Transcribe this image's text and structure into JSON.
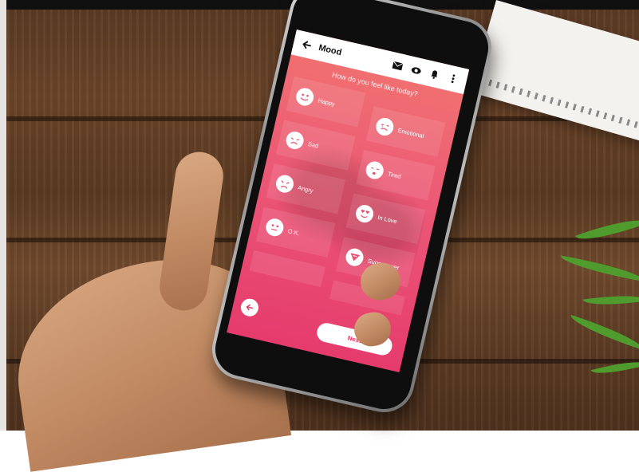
{
  "app_bar": {
    "title": "Mood",
    "back_icon": "arrow-left-icon",
    "icons": [
      "envelope-icon",
      "eye-icon",
      "bell-icon",
      "more-vert-icon"
    ]
  },
  "question": "How do you feel like today?",
  "moods": [
    {
      "label": "Happy",
      "icon": "smile-face-icon"
    },
    {
      "label": "Emotional",
      "icon": "emotional-face-icon"
    },
    {
      "label": "Sad",
      "icon": "sad-face-icon"
    },
    {
      "label": "Tired",
      "icon": "tired-face-icon"
    },
    {
      "label": "Angry",
      "icon": "angry-face-icon"
    },
    {
      "label": "In Love",
      "icon": "heart-eyes-face-icon"
    },
    {
      "label": "O.K.",
      "icon": "neutral-face-icon"
    },
    {
      "label": "Superpower",
      "icon": "superhero-shield-icon"
    }
  ],
  "next_button": {
    "label": "Next"
  },
  "colors": {
    "gradient_top": "#f1746f",
    "gradient_bottom": "#e53b6d",
    "accent": "#e53b6d"
  }
}
